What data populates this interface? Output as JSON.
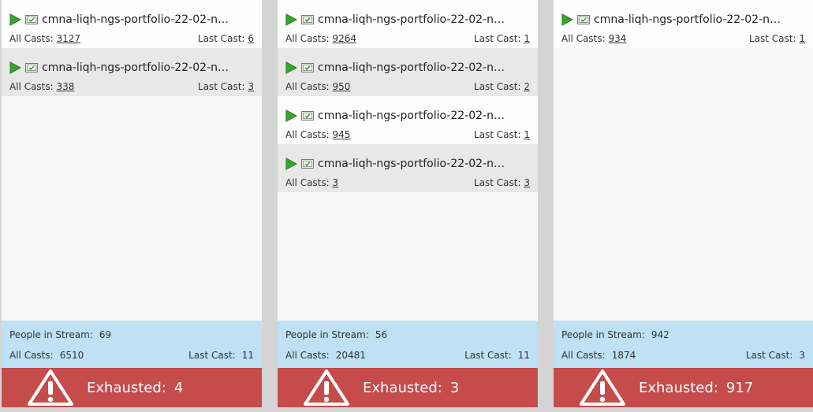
{
  "labels": {
    "all_casts": "All Casts:",
    "last_cast": "Last Cast:",
    "people_in_stream": "People in Stream:",
    "exhausted": "Exhausted:"
  },
  "colors": {
    "background": "#d4d4d4",
    "summary_blue": "#bfe1f4",
    "exhausted_red": "#c64c4c",
    "play_green": "#3aa52e"
  },
  "streams": [
    {
      "programs": [
        {
          "name": "cmna-liqh-ngs-portfolio-22-02-nurt...",
          "all_casts": "3127",
          "last_cast": "6"
        },
        {
          "name": "cmna-liqh-ngs-portfolio-22-02-nurt...",
          "all_casts": "338",
          "last_cast": "3"
        }
      ],
      "people_in_stream": "69",
      "all_casts": "6510",
      "last_cast": "11",
      "exhausted": "4"
    },
    {
      "programs": [
        {
          "name": "cmna-liqh-ngs-portfolio-22-02-nurt...",
          "all_casts": "9264",
          "last_cast": "1"
        },
        {
          "name": "cmna-liqh-ngs-portfolio-22-02-nurt...",
          "all_casts": "950",
          "last_cast": "2"
        },
        {
          "name": "cmna-liqh-ngs-portfolio-22-02-nurt...",
          "all_casts": "945",
          "last_cast": "1"
        },
        {
          "name": "cmna-liqh-ngs-portfolio-22-02-nurt...",
          "all_casts": "3",
          "last_cast": "3"
        }
      ],
      "people_in_stream": "56",
      "all_casts": "20481",
      "last_cast": "11",
      "exhausted": "3"
    },
    {
      "programs": [
        {
          "name": "cmna-liqh-ngs-portfolio-22-02-nurt...",
          "all_casts": "934",
          "last_cast": "1"
        }
      ],
      "people_in_stream": "942",
      "all_casts": "1874",
      "last_cast": "3",
      "exhausted": "917"
    }
  ]
}
